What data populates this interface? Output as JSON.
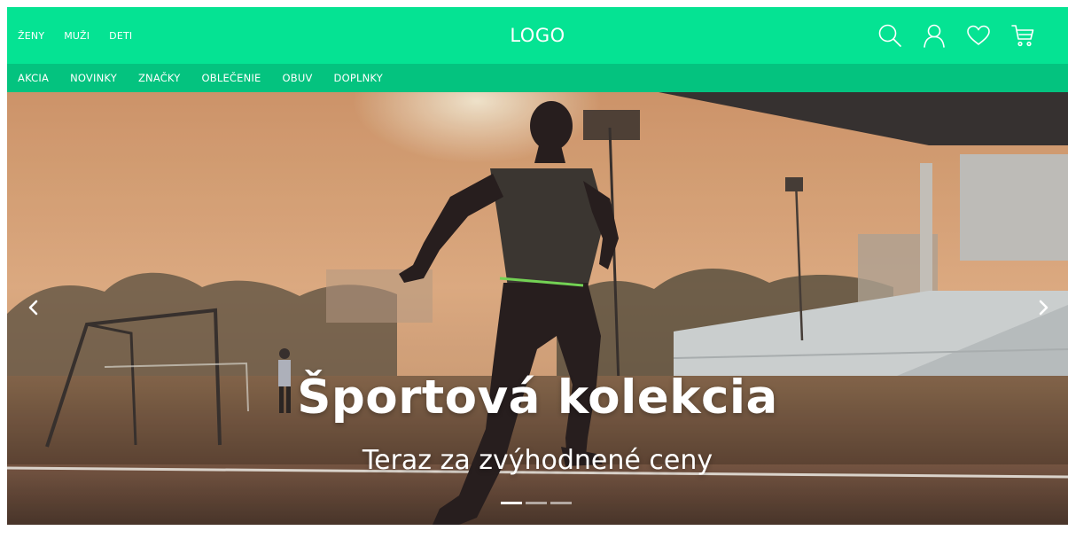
{
  "header": {
    "gender_nav": [
      "ŽENY",
      "MUŽI",
      "DETI"
    ],
    "logo": "LOGO",
    "icons": [
      "search-icon",
      "user-icon",
      "heart-icon",
      "cart-icon"
    ],
    "bg_color": "#05e393"
  },
  "category_nav": {
    "items": [
      "AKCIA",
      "NOVINKY",
      "ZNAČKY",
      "OBLEČENIE",
      "OBUV",
      "DOPLNKY"
    ],
    "bg_color": "#04c37f"
  },
  "hero": {
    "title": "Športová kolekcia",
    "subtitle": "Teraz za zvýhodnené ceny",
    "slide_count": 3,
    "active_slide": 1,
    "prev_icon": "chevron-left-icon",
    "next_icon": "chevron-right-icon"
  }
}
